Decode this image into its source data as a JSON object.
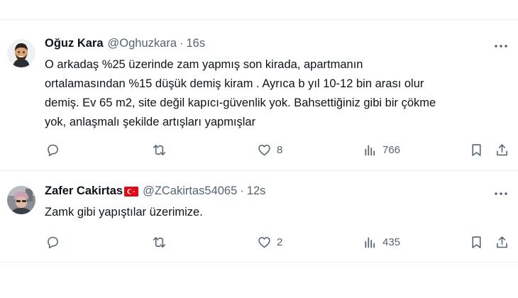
{
  "tweets": [
    {
      "name": "Oğuz Kara",
      "handle": "@Oghuzkara",
      "separator": "·",
      "time": "16s",
      "text_lines": [
        "O arkadaş %25 üzerinde zam yapmış son kirada, apartmanın",
        "ortalamasından %15 düşük demiş kiram . Ayrıca b yıl  10-12 bin  arası olur",
        "demiş. Ev 65 m2, site değil kapıcı-güvenlik yok. Bahsettiğiniz gibi bir çökme",
        "yok, anlaşmalı şekilde artışları yapmışlar"
      ],
      "replies": "",
      "retweets": "",
      "likes": "8",
      "views": "766",
      "avatar_icon": "memoji-avatar"
    },
    {
      "name": "Zafer Cakirtas",
      "handle": "@ZCakirtas54065",
      "separator": "·",
      "time": "12s",
      "flag_icon": "turkey-flag-icon",
      "text_lines": [
        "Zamk gibi yapıştılar üzerimize."
      ],
      "replies": "",
      "retweets": "",
      "likes": "2",
      "views": "435",
      "avatar_icon": "photo-avatar"
    }
  ],
  "colors": {
    "text": "#0f1419",
    "secondary": "#536471",
    "border": "#eff3f4",
    "flag_red": "#e30a17"
  }
}
